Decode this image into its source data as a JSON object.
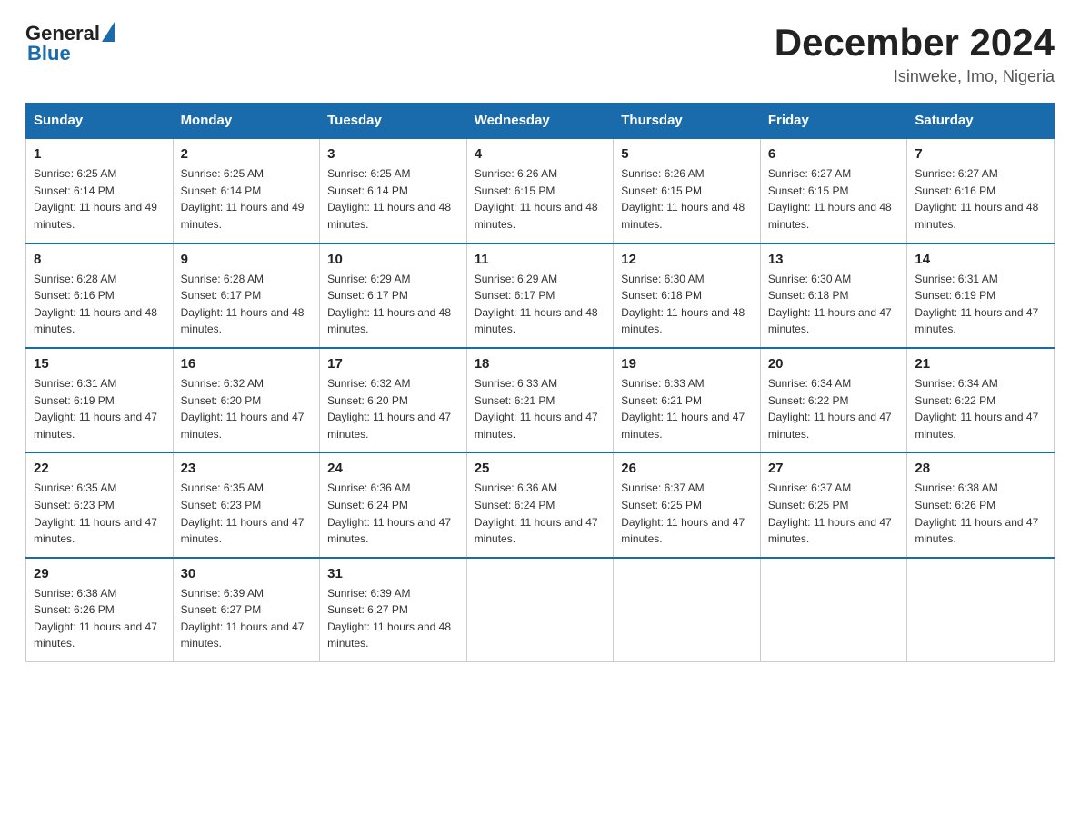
{
  "header": {
    "logo_general": "General",
    "logo_blue": "Blue",
    "main_title": "December 2024",
    "subtitle": "Isinweke, Imo, Nigeria"
  },
  "days_of_week": [
    "Sunday",
    "Monday",
    "Tuesday",
    "Wednesday",
    "Thursday",
    "Friday",
    "Saturday"
  ],
  "weeks": [
    [
      {
        "day": "1",
        "sunrise": "6:25 AM",
        "sunset": "6:14 PM",
        "daylight": "11 hours and 49 minutes."
      },
      {
        "day": "2",
        "sunrise": "6:25 AM",
        "sunset": "6:14 PM",
        "daylight": "11 hours and 49 minutes."
      },
      {
        "day": "3",
        "sunrise": "6:25 AM",
        "sunset": "6:14 PM",
        "daylight": "11 hours and 48 minutes."
      },
      {
        "day": "4",
        "sunrise": "6:26 AM",
        "sunset": "6:15 PM",
        "daylight": "11 hours and 48 minutes."
      },
      {
        "day": "5",
        "sunrise": "6:26 AM",
        "sunset": "6:15 PM",
        "daylight": "11 hours and 48 minutes."
      },
      {
        "day": "6",
        "sunrise": "6:27 AM",
        "sunset": "6:15 PM",
        "daylight": "11 hours and 48 minutes."
      },
      {
        "day": "7",
        "sunrise": "6:27 AM",
        "sunset": "6:16 PM",
        "daylight": "11 hours and 48 minutes."
      }
    ],
    [
      {
        "day": "8",
        "sunrise": "6:28 AM",
        "sunset": "6:16 PM",
        "daylight": "11 hours and 48 minutes."
      },
      {
        "day": "9",
        "sunrise": "6:28 AM",
        "sunset": "6:17 PM",
        "daylight": "11 hours and 48 minutes."
      },
      {
        "day": "10",
        "sunrise": "6:29 AM",
        "sunset": "6:17 PM",
        "daylight": "11 hours and 48 minutes."
      },
      {
        "day": "11",
        "sunrise": "6:29 AM",
        "sunset": "6:17 PM",
        "daylight": "11 hours and 48 minutes."
      },
      {
        "day": "12",
        "sunrise": "6:30 AM",
        "sunset": "6:18 PM",
        "daylight": "11 hours and 48 minutes."
      },
      {
        "day": "13",
        "sunrise": "6:30 AM",
        "sunset": "6:18 PM",
        "daylight": "11 hours and 47 minutes."
      },
      {
        "day": "14",
        "sunrise": "6:31 AM",
        "sunset": "6:19 PM",
        "daylight": "11 hours and 47 minutes."
      }
    ],
    [
      {
        "day": "15",
        "sunrise": "6:31 AM",
        "sunset": "6:19 PM",
        "daylight": "11 hours and 47 minutes."
      },
      {
        "day": "16",
        "sunrise": "6:32 AM",
        "sunset": "6:20 PM",
        "daylight": "11 hours and 47 minutes."
      },
      {
        "day": "17",
        "sunrise": "6:32 AM",
        "sunset": "6:20 PM",
        "daylight": "11 hours and 47 minutes."
      },
      {
        "day": "18",
        "sunrise": "6:33 AM",
        "sunset": "6:21 PM",
        "daylight": "11 hours and 47 minutes."
      },
      {
        "day": "19",
        "sunrise": "6:33 AM",
        "sunset": "6:21 PM",
        "daylight": "11 hours and 47 minutes."
      },
      {
        "day": "20",
        "sunrise": "6:34 AM",
        "sunset": "6:22 PM",
        "daylight": "11 hours and 47 minutes."
      },
      {
        "day": "21",
        "sunrise": "6:34 AM",
        "sunset": "6:22 PM",
        "daylight": "11 hours and 47 minutes."
      }
    ],
    [
      {
        "day": "22",
        "sunrise": "6:35 AM",
        "sunset": "6:23 PM",
        "daylight": "11 hours and 47 minutes."
      },
      {
        "day": "23",
        "sunrise": "6:35 AM",
        "sunset": "6:23 PM",
        "daylight": "11 hours and 47 minutes."
      },
      {
        "day": "24",
        "sunrise": "6:36 AM",
        "sunset": "6:24 PM",
        "daylight": "11 hours and 47 minutes."
      },
      {
        "day": "25",
        "sunrise": "6:36 AM",
        "sunset": "6:24 PM",
        "daylight": "11 hours and 47 minutes."
      },
      {
        "day": "26",
        "sunrise": "6:37 AM",
        "sunset": "6:25 PM",
        "daylight": "11 hours and 47 minutes."
      },
      {
        "day": "27",
        "sunrise": "6:37 AM",
        "sunset": "6:25 PM",
        "daylight": "11 hours and 47 minutes."
      },
      {
        "day": "28",
        "sunrise": "6:38 AM",
        "sunset": "6:26 PM",
        "daylight": "11 hours and 47 minutes."
      }
    ],
    [
      {
        "day": "29",
        "sunrise": "6:38 AM",
        "sunset": "6:26 PM",
        "daylight": "11 hours and 47 minutes."
      },
      {
        "day": "30",
        "sunrise": "6:39 AM",
        "sunset": "6:27 PM",
        "daylight": "11 hours and 47 minutes."
      },
      {
        "day": "31",
        "sunrise": "6:39 AM",
        "sunset": "6:27 PM",
        "daylight": "11 hours and 48 minutes."
      },
      null,
      null,
      null,
      null
    ]
  ]
}
